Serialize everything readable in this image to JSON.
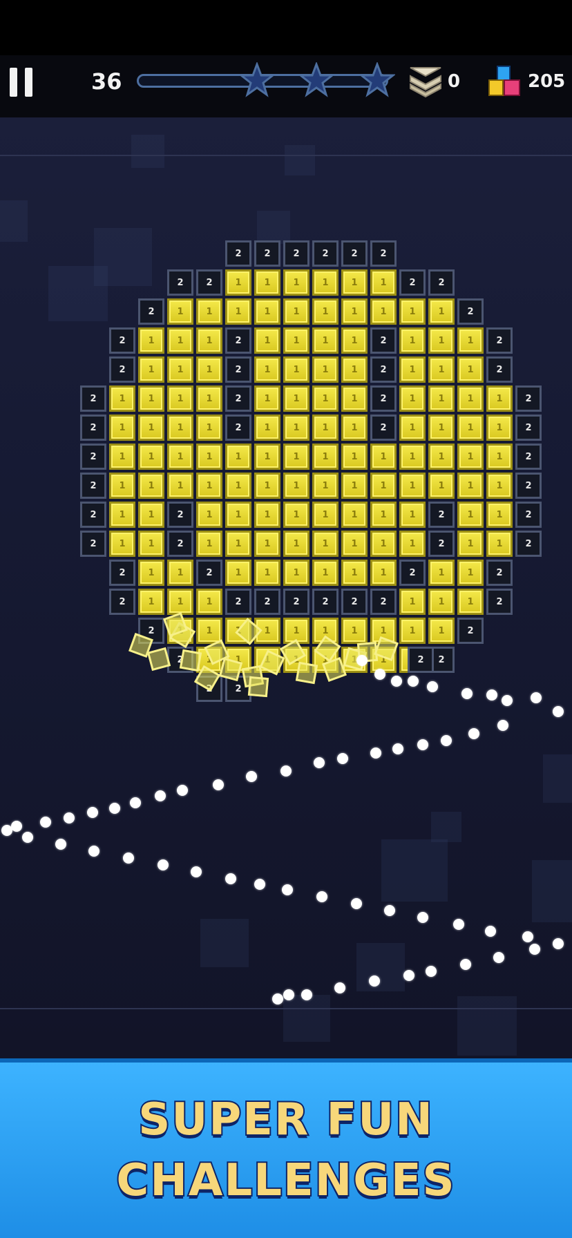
{
  "hud": {
    "level": "36",
    "stars_total": 3,
    "downs_count": "0",
    "blocks_count": "205",
    "colors": {
      "track": "#4d6fa0",
      "star": "#233c78"
    }
  },
  "icons": [
    "pause-icon",
    "star-icon",
    "chevron-stack-icon",
    "blocks-icon"
  ],
  "board": {
    "brick_value": "2",
    "colors": {
      "yellow": "#e8dc30",
      "dark": "#141824"
    }
  },
  "banner": {
    "line1": "SUPER FUN",
    "line2": "CHALLENGES",
    "colors": {
      "background": "#2ba0f2",
      "text": "#f7d77a",
      "outline": "#0e2466"
    }
  }
}
